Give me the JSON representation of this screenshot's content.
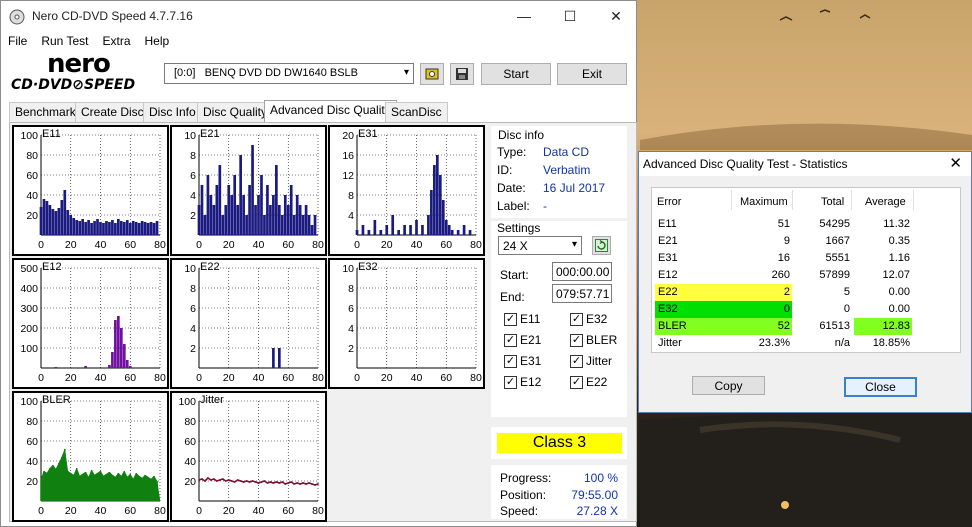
{
  "main": {
    "title": "Nero CD-DVD Speed 4.7.7.16",
    "menus": [
      "File",
      "Run Test",
      "Extra",
      "Help"
    ],
    "logo_top": "nero",
    "logo_bottom": "CD·DVD⊘SPEED",
    "drive": "[0:0]   BENQ DVD DD DW1640 BSLB",
    "start_label": "Start",
    "exit_label": "Exit",
    "tabs": [
      "Benchmark",
      "Create Disc",
      "Disc Info",
      "Disc Quality",
      "Advanced Disc Quality",
      "ScanDisc"
    ],
    "disc_info": {
      "heading": "Disc info",
      "type_label": "Type:",
      "type_value": "Data CD",
      "id_label": "ID:",
      "id_value": "Verbatim",
      "date_label": "Date:",
      "date_value": "16 Jul 2017",
      "label_label": "Label:",
      "label_value": "-"
    },
    "settings": {
      "heading": "Settings",
      "speed": "24 X",
      "start_label": "Start:",
      "start_value": "000:00.00",
      "end_label": "End:",
      "end_value": "079:57.71",
      "checks": [
        {
          "label": "E11",
          "checked": true
        },
        {
          "label": "E32",
          "checked": true
        },
        {
          "label": "E21",
          "checked": true
        },
        {
          "label": "BLER",
          "checked": true
        },
        {
          "label": "E31",
          "checked": true
        },
        {
          "label": "Jitter",
          "checked": true
        },
        {
          "label": "E12",
          "checked": true
        },
        {
          "label": "E22",
          "checked": true
        }
      ]
    },
    "class_label": "Class 3",
    "progress": {
      "progress_label": "Progress:",
      "progress_value": "100 %",
      "position_label": "Position:",
      "position_value": "79:55.00",
      "speed_label": "Speed:",
      "speed_value": "27.28 X"
    }
  },
  "stats": {
    "title": "Advanced Disc Quality Test - Statistics",
    "headers": [
      "Error",
      "Maximum",
      "Total",
      "Average"
    ],
    "rows": [
      {
        "error": "E11",
        "maximum": "51",
        "total": "54295",
        "average": "11.32"
      },
      {
        "error": "E21",
        "maximum": "9",
        "total": "1667",
        "average": "0.35"
      },
      {
        "error": "E31",
        "maximum": "16",
        "total": "5551",
        "average": "1.16"
      },
      {
        "error": "E12",
        "maximum": "260",
        "total": "57899",
        "average": "12.07"
      },
      {
        "error": "E22",
        "maximum": "2",
        "total": "5",
        "average": "0.00"
      },
      {
        "error": "E32",
        "maximum": "0",
        "total": "0",
        "average": "0.00"
      },
      {
        "error": "BLER",
        "maximum": "52",
        "total": "61513",
        "average": "12.83"
      },
      {
        "error": "Jitter",
        "maximum": "23.3%",
        "total": "n/a",
        "average": "18.85%"
      }
    ],
    "copy_label": "Copy",
    "close_label": "Close"
  },
  "colors": {
    "bar": "#1a1a80",
    "e12_bar": "#7010a0",
    "bler_bar": "#108010",
    "jitter_line": "#801030",
    "class_yellow": "#ffff00",
    "highlight_yellow": "#ffff40",
    "highlight_green": "#00e000",
    "highlight_lime": "#80ff20"
  },
  "chart_data": [
    {
      "type": "bar",
      "title": "E11",
      "x_ticks": [
        "0",
        "20",
        "40",
        "60",
        "80"
      ],
      "y_ticks": [
        "100",
        "80",
        "60",
        "40",
        "20"
      ],
      "ylim": [
        0,
        100
      ],
      "xlim": [
        0,
        80
      ],
      "x": [
        0,
        2,
        4,
        6,
        8,
        10,
        12,
        14,
        16,
        18,
        20,
        22,
        24,
        26,
        28,
        30,
        32,
        34,
        36,
        38,
        40,
        42,
        44,
        46,
        48,
        50,
        52,
        54,
        56,
        58,
        60,
        62,
        64,
        66,
        68,
        70,
        72,
        74,
        76,
        78,
        80
      ],
      "values": [
        28,
        36,
        34,
        30,
        26,
        24,
        27,
        35,
        45,
        25,
        20,
        17,
        15,
        14,
        16,
        13,
        15,
        12,
        14,
        16,
        13,
        12,
        14,
        13,
        15,
        12,
        16,
        14,
        13,
        15,
        12,
        14,
        13,
        12,
        14,
        13,
        12,
        13,
        12,
        14,
        0
      ]
    },
    {
      "type": "bar",
      "title": "E21",
      "x_ticks": [
        "0",
        "20",
        "40",
        "60",
        "80"
      ],
      "y_ticks": [
        "10",
        "8",
        "6",
        "4",
        "2"
      ],
      "ylim": [
        0,
        10
      ],
      "xlim": [
        0,
        80
      ],
      "x": [
        0,
        2,
        4,
        6,
        8,
        10,
        12,
        14,
        16,
        18,
        20,
        22,
        24,
        26,
        28,
        30,
        32,
        34,
        36,
        38,
        40,
        42,
        44,
        46,
        48,
        50,
        52,
        54,
        56,
        58,
        60,
        62,
        64,
        66,
        68,
        70,
        72,
        74,
        76,
        78,
        80
      ],
      "values": [
        3,
        5,
        2,
        6,
        4,
        3,
        5,
        7,
        2,
        3,
        5,
        4,
        6,
        3,
        8,
        4,
        2,
        5,
        9,
        3,
        4,
        6,
        2,
        5,
        3,
        4,
        7,
        3,
        2,
        4,
        3,
        5,
        2,
        4,
        3,
        2,
        3,
        2,
        1,
        2,
        0
      ]
    },
    {
      "type": "bar",
      "title": "E31",
      "x_ticks": [
        "0",
        "20",
        "40",
        "60",
        "80"
      ],
      "y_ticks": [
        "20",
        "16",
        "12",
        "8",
        "4"
      ],
      "ylim": [
        0,
        20
      ],
      "xlim": [
        0,
        80
      ],
      "x": [
        0,
        4,
        8,
        12,
        16,
        20,
        24,
        28,
        32,
        36,
        40,
        44,
        48,
        50,
        52,
        54,
        56,
        58,
        60,
        62,
        64,
        68,
        72,
        76,
        80
      ],
      "values": [
        1,
        2,
        1,
        3,
        1,
        2,
        4,
        1,
        2,
        2,
        3,
        2,
        4,
        9,
        14,
        16,
        12,
        7,
        3,
        2,
        1,
        1,
        2,
        1,
        0
      ]
    },
    {
      "type": "bar",
      "title": "E12",
      "x_ticks": [
        "0",
        "20",
        "40",
        "60",
        "80"
      ],
      "y_ticks": [
        "500",
        "400",
        "300",
        "200",
        "100"
      ],
      "ylim": [
        0,
        500
      ],
      "xlim": [
        0,
        80
      ],
      "x": [
        0,
        10,
        20,
        30,
        40,
        46,
        48,
        50,
        52,
        54,
        56,
        58,
        60,
        70,
        80
      ],
      "values": [
        0,
        5,
        0,
        10,
        0,
        15,
        80,
        240,
        260,
        200,
        120,
        40,
        10,
        0,
        0
      ]
    },
    {
      "type": "bar",
      "title": "E22",
      "x_ticks": [
        "0",
        "20",
        "40",
        "60",
        "80"
      ],
      "y_ticks": [
        "10",
        "8",
        "6",
        "4",
        "2"
      ],
      "ylim": [
        0,
        10
      ],
      "xlim": [
        0,
        80
      ],
      "x": [
        0,
        20,
        40,
        48,
        50,
        52,
        54,
        60,
        80
      ],
      "values": [
        0,
        0,
        0,
        0,
        2,
        0,
        2,
        0,
        0
      ]
    },
    {
      "type": "bar",
      "title": "E32",
      "x_ticks": [
        "0",
        "20",
        "40",
        "60",
        "80"
      ],
      "y_ticks": [
        "10",
        "8",
        "6",
        "4",
        "2"
      ],
      "ylim": [
        0,
        10
      ],
      "xlim": [
        0,
        80
      ],
      "x": [
        0,
        20,
        40,
        60,
        80
      ],
      "values": [
        0,
        0,
        0,
        0,
        0
      ]
    },
    {
      "type": "area",
      "title": "BLER",
      "x_ticks": [
        "0",
        "20",
        "40",
        "60",
        "80"
      ],
      "y_ticks": [
        "100",
        "80",
        "60",
        "40",
        "20"
      ],
      "ylim": [
        0,
        100
      ],
      "xlim": [
        0,
        80
      ],
      "x": [
        0,
        2,
        4,
        6,
        8,
        10,
        12,
        14,
        16,
        18,
        20,
        22,
        24,
        26,
        28,
        30,
        32,
        34,
        36,
        38,
        40,
        42,
        44,
        46,
        48,
        50,
        52,
        54,
        56,
        58,
        60,
        62,
        64,
        66,
        68,
        70,
        72,
        74,
        76,
        78,
        80
      ],
      "values": [
        22,
        30,
        28,
        33,
        36,
        32,
        38,
        44,
        52,
        30,
        28,
        26,
        33,
        25,
        27,
        29,
        24,
        31,
        26,
        28,
        30,
        25,
        27,
        29,
        26,
        24,
        28,
        25,
        30,
        24,
        27,
        22,
        28,
        25,
        23,
        26,
        24,
        22,
        25,
        20,
        0
      ]
    },
    {
      "type": "line",
      "title": "Jitter",
      "x_ticks": [
        "0",
        "20",
        "40",
        "60",
        "80"
      ],
      "y_ticks": [
        "100",
        "80",
        "60",
        "40",
        "20"
      ],
      "ylim": [
        0,
        100
      ],
      "xlim": [
        0,
        80
      ],
      "x": [
        0,
        2,
        4,
        6,
        8,
        10,
        12,
        14,
        16,
        18,
        20,
        22,
        24,
        26,
        28,
        30,
        32,
        34,
        36,
        38,
        40,
        42,
        44,
        46,
        48,
        50,
        52,
        54,
        56,
        58,
        60,
        62,
        64,
        66,
        68,
        70,
        72,
        74,
        76,
        78,
        80
      ],
      "values": [
        21,
        22,
        20,
        23,
        21,
        22,
        20,
        21,
        22,
        20,
        21,
        20,
        19,
        21,
        20,
        19,
        20,
        19,
        20,
        19,
        18,
        19,
        20,
        18,
        19,
        18,
        19,
        18,
        19,
        17,
        18,
        19,
        17,
        18,
        17,
        18,
        17,
        18,
        17,
        16,
        17
      ]
    }
  ]
}
